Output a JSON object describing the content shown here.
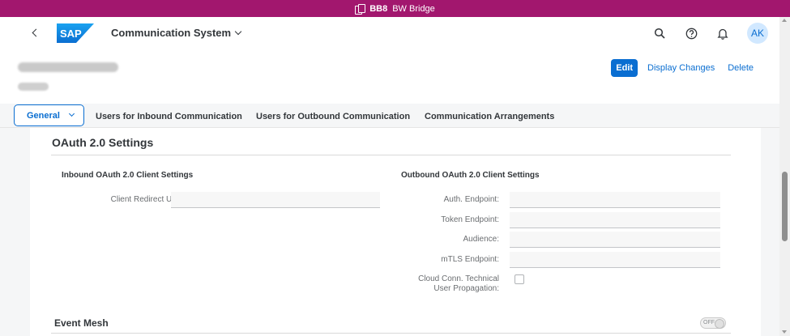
{
  "system_bar": {
    "system_id": "BB8",
    "system_name": "BW Bridge"
  },
  "shell": {
    "app_title": "Communication System",
    "avatar_initials": "AK",
    "logo_text": "SAP",
    "brand_color": "#0a6ed1"
  },
  "object_header": {
    "actions": {
      "edit": "Edit",
      "display_changes": "Display Changes",
      "delete": "Delete"
    }
  },
  "tabs": [
    {
      "label": "General"
    },
    {
      "label": "Users for Inbound Communication"
    },
    {
      "label": "Users for Outbound Communication"
    },
    {
      "label": "Communication Arrangements"
    }
  ],
  "oauth": {
    "section_title": "OAuth 2.0 Settings",
    "inbound": {
      "title": "Inbound OAuth 2.0 Client Settings",
      "fields": [
        {
          "label": "Client Redirect URI:",
          "value": ""
        }
      ]
    },
    "outbound": {
      "title": "Outbound OAuth 2.0 Client Settings",
      "fields": [
        {
          "label": "Auth. Endpoint:",
          "value": ""
        },
        {
          "label": "Token Endpoint:",
          "value": ""
        },
        {
          "label": "Audience:",
          "value": ""
        },
        {
          "label": "mTLS Endpoint:",
          "value": ""
        }
      ],
      "checkbox": {
        "label_line1": "Cloud Conn. Technical",
        "label_line2": "User Propagation:",
        "checked": false
      }
    }
  },
  "event_mesh": {
    "title": "Event Mesh",
    "switch_label": "OFF",
    "enabled": false
  }
}
